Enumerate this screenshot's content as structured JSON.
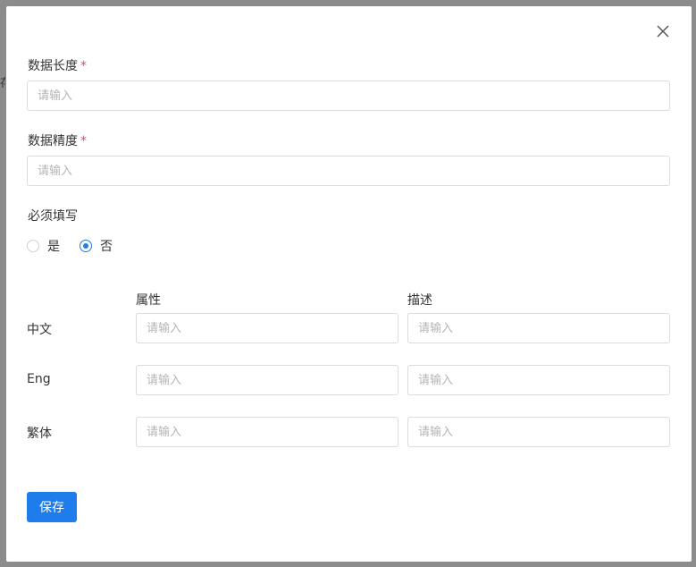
{
  "backdrop": {
    "partial_text": "存"
  },
  "dialog": {
    "close_icon": "close-icon",
    "fields": {
      "data_length": {
        "label": "数据长度",
        "required_mark": "*",
        "placeholder": "请输入",
        "value": ""
      },
      "data_precision": {
        "label": "数据精度",
        "required_mark": "*",
        "placeholder": "请输入",
        "value": ""
      }
    },
    "required": {
      "label": "必须填写",
      "options": [
        {
          "label": "是",
          "selected": false
        },
        {
          "label": "否",
          "selected": true
        }
      ]
    },
    "i18n": {
      "columns": [
        "属性",
        "描述"
      ],
      "rows": [
        {
          "label": "中文",
          "attr_placeholder": "请输入",
          "desc_placeholder": "请输入"
        },
        {
          "label": "Eng",
          "attr_placeholder": "请输入",
          "desc_placeholder": "请输入"
        },
        {
          "label": "繁体",
          "attr_placeholder": "请输入",
          "desc_placeholder": "请输入"
        }
      ]
    },
    "save_label": "保存"
  },
  "colors": {
    "primary": "#1f7ceb",
    "required_star": "#e34d59",
    "overlay": "#8c8c8c"
  }
}
